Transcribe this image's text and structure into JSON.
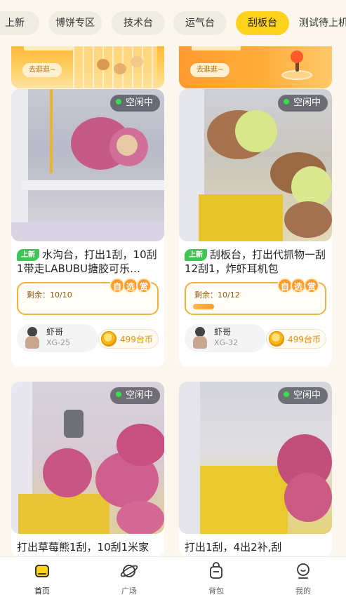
{
  "tabs": [
    {
      "label": "上新",
      "active": false
    },
    {
      "label": "博饼专区",
      "active": false
    },
    {
      "label": "技术台",
      "active": false
    },
    {
      "label": "运气台",
      "active": false
    },
    {
      "label": "刮板台",
      "active": true
    },
    {
      "label": "测试待上机",
      "active": false
    }
  ],
  "banners": [
    {
      "go_label": "去逛逛~"
    },
    {
      "go_label": "去逛逛~"
    }
  ],
  "cards": [
    {
      "status": "空闲中",
      "new_tag": "上新",
      "title": "水沟台，打出1刮，10刮1带走LABUBU搪胶可乐…",
      "remain": "剩余：10/10",
      "progress": 0,
      "badges": [
        "自",
        "选",
        "赏"
      ],
      "host_name": "虾哥",
      "host_code": "XG-25",
      "price": "499台币"
    },
    {
      "status": "空闲中",
      "new_tag": "上新",
      "title": "刮板台，打出代抓物一刮12刮1，炸虾耳机包",
      "remain": "剩余：10/12",
      "progress": 0.17,
      "badges": [
        "自",
        "选",
        "赏"
      ],
      "host_name": "虾哥",
      "host_code": "XG-32",
      "price": "499台币"
    },
    {
      "status": "空闲中",
      "title": "打出草莓熊1刮，10刮1米家"
    },
    {
      "status": "空闲中",
      "title": "打出1刮，4出2补,刮"
    }
  ],
  "nav": [
    {
      "label": "首页",
      "icon": "home-icon",
      "active": true
    },
    {
      "label": "广场",
      "icon": "planet-icon",
      "active": false
    },
    {
      "label": "背包",
      "icon": "backpack-icon",
      "active": false
    },
    {
      "label": "我的",
      "icon": "profile-icon",
      "active": false
    }
  ],
  "colors": {
    "accent": "#ffd21e",
    "status_dot": "#35e04a",
    "new_tag": "#3fc554",
    "price": "#e88f07",
    "remain_border": "#f3b040"
  }
}
